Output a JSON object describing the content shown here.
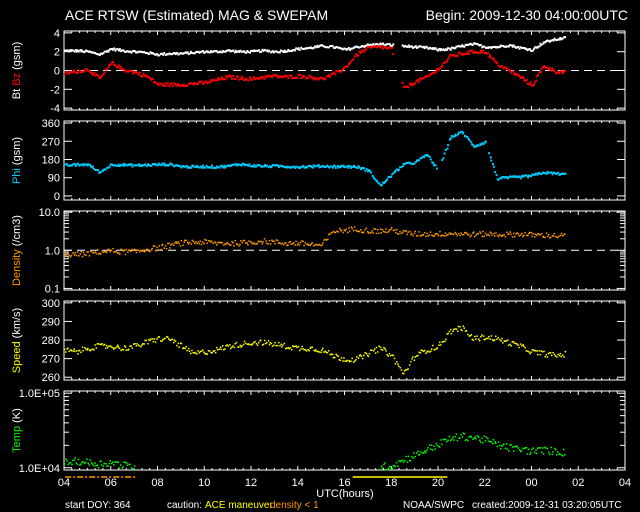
{
  "header": {
    "title": "ACE RTSW (Estimated) MAG & SWEPAM",
    "begin": "Begin: 2009-12-30 04:00:00UTC"
  },
  "footer": {
    "start_doy": "start DOY: 364",
    "caution": "caution:",
    "ace_maneuver": "ACE maneuver",
    "density_lt1": "density < 1",
    "source": "NOAA/SWPC",
    "created": "created:2009-12-31 03:20:05UTC"
  },
  "colors": {
    "bt": "#ffffff",
    "bz": "#ff0000",
    "phi": "#00ccff",
    "density": "#ff9900",
    "speed": "#ffff00",
    "temp": "#00ff00"
  },
  "chart_data": {
    "type": "scatter",
    "title": "ACE RTSW (Estimated) MAG & SWEPAM",
    "xlabel": "UTC(hours)",
    "xlim": [
      4,
      28
    ],
    "x_tick_labels": [
      "04",
      "06",
      "08",
      "10",
      "12",
      "14",
      "16",
      "18",
      "20",
      "22",
      "00",
      "02",
      "04"
    ],
    "t": [
      4,
      4.5,
      5,
      5.5,
      6,
      6.5,
      7,
      7.5,
      8,
      8.5,
      9,
      9.5,
      10,
      10.5,
      11,
      11.5,
      12,
      12.5,
      13,
      13.5,
      14,
      14.5,
      15,
      15.5,
      16,
      16.5,
      17,
      17.5,
      18,
      18.5,
      19,
      19.5,
      20,
      20.5,
      21,
      21.5,
      22,
      22.5,
      23,
      23.5,
      24,
      24.5,
      25,
      25.5
    ],
    "caution_intervals": [
      {
        "label": "density < 1",
        "color": "#ff9900",
        "start": 4.05,
        "end": 7.1
      },
      {
        "label": "ACE maneuver",
        "color": "#ffff00",
        "start": 16.35,
        "end": 20.4
      }
    ],
    "panels": [
      {
        "id": "mag",
        "ylabel_parts": [
          "Bt",
          "Bz",
          "(gsm)"
        ],
        "ylim": [
          -4.2,
          4.2
        ],
        "scale": "linear",
        "ticks": [
          -4,
          -2,
          0,
          2,
          4
        ],
        "tick_labels": [
          "-4",
          "-2",
          "0",
          "2",
          "4"
        ],
        "ref_line": 0,
        "gaps": [
          [
            18.1,
            18.45
          ]
        ],
        "series": [
          {
            "name": "Bt",
            "values": [
              2.2,
              2.2,
              2.1,
              1.8,
              2.4,
              2.2,
              2.1,
              2.0,
              1.8,
              1.9,
              1.9,
              2.0,
              2.1,
              2.1,
              2.2,
              2.1,
              2.1,
              2.2,
              2.1,
              2.2,
              2.4,
              2.5,
              2.7,
              2.6,
              2.3,
              2.6,
              2.8,
              2.9,
              2.8,
              2.7,
              2.6,
              2.5,
              2.3,
              2.4,
              2.7,
              2.9,
              2.6,
              2.6,
              2.8,
              2.5,
              2.3,
              3.1,
              3.4,
              3.6
            ]
          },
          {
            "name": "Bz",
            "values": [
              -0.2,
              0.0,
              0.2,
              -0.8,
              0.9,
              0.2,
              -0.1,
              -0.5,
              -1.4,
              -1.4,
              -1.4,
              -1.3,
              -1.2,
              -0.9,
              -0.6,
              -0.7,
              -0.8,
              -0.6,
              -0.5,
              -0.6,
              -0.5,
              -0.6,
              -0.8,
              -0.3,
              0.4,
              1.8,
              2.5,
              2.6,
              2.4,
              -1.8,
              -1.1,
              -0.6,
              0.3,
              1.6,
              1.9,
              2.1,
              2.1,
              0.8,
              0.1,
              -0.6,
              -1.5,
              0.6,
              0.0,
              -0.1
            ]
          }
        ]
      },
      {
        "id": "phi",
        "ylabel_parts": [
          "Phi",
          "(gsm)"
        ],
        "ylim": [
          -20,
          370
        ],
        "scale": "linear",
        "ticks": [
          0,
          90,
          180,
          270,
          360
        ],
        "tick_labels": [
          "0",
          "90",
          "180",
          "270",
          "360"
        ],
        "gaps": [
          [
            19.95,
            20.15
          ],
          [
            22.05,
            22.15
          ]
        ],
        "series": [
          {
            "name": "Phi",
            "values": [
              155,
              158,
              160,
              120,
              160,
              158,
              155,
              157,
              160,
              160,
              150,
              148,
              150,
              148,
              152,
              162,
              155,
              152,
              152,
              150,
              148,
              150,
              152,
              150,
              150,
              148,
              130,
              55,
              110,
              160,
              170,
              210,
              125,
              295,
              320,
              250,
              270,
              90,
              95,
              98,
              105,
              120,
              115,
              110
            ]
          }
        ]
      },
      {
        "id": "density",
        "ylabel_parts": [
          "Density",
          "(/cm3)"
        ],
        "ylim": [
          0.091,
          10.7
        ],
        "scale": "log",
        "ticks": [
          0.1,
          1.0,
          10.0
        ],
        "tick_labels": [
          "0.1",
          "1.0",
          "10.0"
        ],
        "ref_line": 1.0,
        "gaps": [],
        "series": [
          {
            "name": "Density",
            "values": [
              0.8,
              0.8,
              0.85,
              0.95,
              1.0,
              0.95,
              0.95,
              1.1,
              1.2,
              1.4,
              1.6,
              1.7,
              1.7,
              1.6,
              1.6,
              1.6,
              1.7,
              1.8,
              1.7,
              1.6,
              1.6,
              1.5,
              1.4,
              3.3,
              3.5,
              3.8,
              3.4,
              3.3,
              3.5,
              3.0,
              2.8,
              2.8,
              2.8,
              2.9,
              2.8,
              2.7,
              2.8,
              2.7,
              2.7,
              2.8,
              2.6,
              2.6,
              2.5,
              2.5
            ]
          }
        ]
      },
      {
        "id": "speed",
        "ylabel_parts": [
          "Speed",
          "(km/s)"
        ],
        "ylim": [
          258.5,
          301
        ],
        "scale": "linear",
        "ticks": [
          260,
          270,
          280,
          290,
          300
        ],
        "tick_labels": [
          "260",
          "270",
          "280",
          "290",
          "300"
        ],
        "gaps": [],
        "series": [
          {
            "name": "Speed",
            "values": [
              275,
              274,
              276,
              277,
              277,
              276,
              277,
              279,
              281,
              281,
              277,
              273,
              274,
              275,
              277,
              278,
              279,
              279,
              278,
              277,
              276,
              276,
              275,
              272,
              270,
              270,
              273,
              276,
              272,
              262,
              272,
              275,
              277,
              285,
              287,
              281,
              282,
              281,
              279,
              277,
              274,
              273,
              272,
              273
            ]
          }
        ]
      },
      {
        "id": "temp",
        "ylabel_parts": [
          "Temp",
          "(K)"
        ],
        "ylim": [
          9330,
          107000
        ],
        "scale": "log",
        "ticks": [
          10000,
          100000
        ],
        "tick_labels": [
          "1.0E+04",
          "1.0E+05"
        ],
        "gaps": [],
        "series": [
          {
            "name": "Temp",
            "values": [
              12000,
              12500,
              12000,
              11500,
              12000,
              11000,
              10500,
              null,
              null,
              null,
              null,
              null,
              null,
              null,
              null,
              null,
              null,
              null,
              null,
              null,
              null,
              null,
              null,
              null,
              null,
              null,
              null,
              10500,
              10800,
              13000,
              15000,
              18000,
              21000,
              25000,
              27000,
              26000,
              24000,
              21000,
              19000,
              18000,
              17000,
              17500,
              17000,
              16000
            ]
          }
        ]
      }
    ]
  }
}
